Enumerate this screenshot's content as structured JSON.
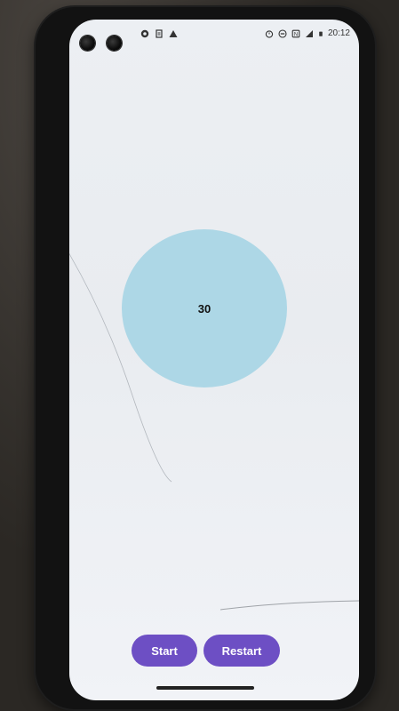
{
  "status_bar": {
    "time": "20:12",
    "left_icons": [
      "notification-icon",
      "file-icon",
      "alert-icon"
    ],
    "right_icons": [
      "alarm-icon",
      "dnd-icon",
      "nfc-icon",
      "signal-icon",
      "battery-icon"
    ]
  },
  "timer": {
    "value": "30",
    "color": "#add7e6"
  },
  "controls": {
    "start_label": "Start",
    "restart_label": "Restart",
    "accent": "#6d4fc4"
  }
}
